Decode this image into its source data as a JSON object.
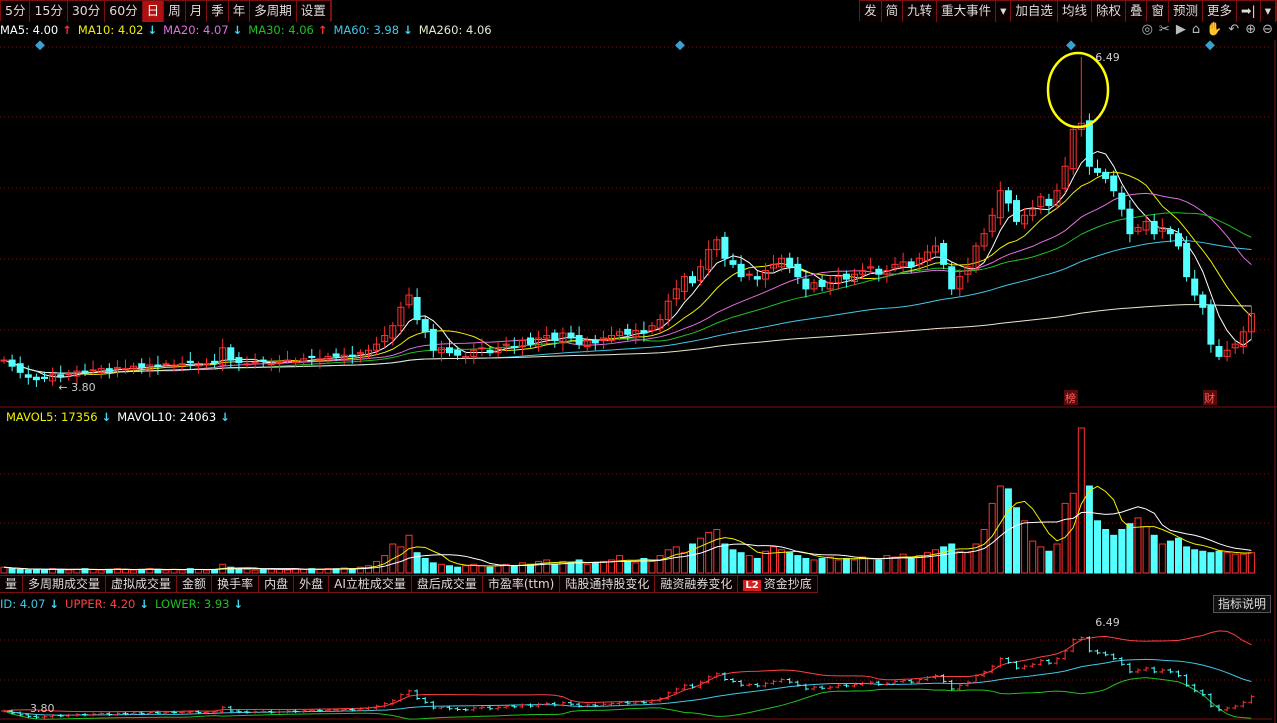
{
  "toolbar_left": [
    "5分",
    "15分",
    "30分",
    "60分",
    "日",
    "周",
    "月",
    "季",
    "年",
    "多周期",
    "设置"
  ],
  "toolbar_left_active": "日",
  "toolbar_right": [
    "发",
    "简",
    "九转",
    "重大事件",
    "▾",
    "加自选",
    "均线",
    "除权",
    "叠",
    "窗",
    "预测",
    "更多",
    "➡|",
    "▾"
  ],
  "chart_icons": [
    "eye-icon",
    "scissors-icon",
    "play-icon",
    "lock-icon",
    "hand-icon",
    "undo-icon",
    "zoom-in-icon",
    "zoom-out-icon"
  ],
  "chart_icon_glyphs": [
    "◎",
    "✂",
    "▶",
    "⌂",
    "✋",
    "↶",
    "⊕",
    "⊖"
  ],
  "ma_legend": [
    {
      "label": "MA5: 4.00",
      "arrow": "↑",
      "color": "#ffffff",
      "trend": "up"
    },
    {
      "label": "MA10: 4.02",
      "arrow": "↓",
      "color": "#f0f000",
      "trend": "down"
    },
    {
      "label": "MA20: 4.07",
      "arrow": "↓",
      "color": "#e070e0",
      "trend": "down"
    },
    {
      "label": "MA30: 4.06",
      "arrow": "↑",
      "color": "#20c020",
      "trend": "up"
    },
    {
      "label": "MA60: 3.98",
      "arrow": "↓",
      "color": "#40c8e8",
      "trend": "down"
    },
    {
      "label": "MA260: 4.06",
      "arrow": "",
      "color": "#e8e8d0",
      "trend": ""
    }
  ],
  "vol_legend": [
    {
      "label": "MAVOL5: 17356",
      "arrow": "↓",
      "color": "#f0f000"
    },
    {
      "label": "MAVOL10: 24063",
      "arrow": "↓",
      "color": "#ffffff"
    }
  ],
  "boll_legend": [
    {
      "label": "ID: 4.07",
      "arrow": "↓",
      "color": "#40c8e8"
    },
    {
      "label": "UPPER: 4.20",
      "arrow": "↓",
      "color": "#ff4040"
    },
    {
      "label": "LOWER: 3.93",
      "arrow": "↓",
      "color": "#20c020"
    }
  ],
  "indicator_tabs": [
    "量",
    "多周期成交量",
    "虚拟成交量",
    "金额",
    "换手率",
    "内盘",
    "外盘",
    "AI立桩成交量",
    "盘后成交量",
    "市盈率(ttm)",
    "陆股通持股变化",
    "融资融券变化",
    "资金抄底"
  ],
  "indicator_tab_badge": "L2",
  "explain_button": "指标说明",
  "markers": {
    "high_label": "6.49",
    "low_label": "3.80",
    "event_labels": [
      "榜",
      "财"
    ]
  },
  "colors": {
    "up": "#ff3030",
    "down": "#54ffff",
    "grid": "#7a1010",
    "highlight_circle": "#ffff00",
    "diamond": "#3aa0d0"
  },
  "chart_data": {
    "type": "candlestick",
    "price_high": 6.49,
    "price_low": 3.8,
    "close": [
      4.02,
      3.97,
      3.92,
      3.88,
      3.86,
      3.87,
      3.9,
      3.89,
      3.91,
      3.93,
      3.92,
      3.94,
      3.95,
      3.93,
      3.96,
      3.95,
      3.97,
      3.96,
      3.98,
      3.97,
      3.99,
      3.98,
      3.99,
      4.0,
      3.98,
      3.99,
      4.0,
      4.12,
      4.02,
      4.0,
      3.99,
      4.0,
      4.01,
      3.99,
      4.0,
      4.02,
      4.01,
      4.03,
      4.04,
      4.03,
      4.05,
      4.05,
      4.06,
      4.05,
      4.08,
      4.1,
      4.15,
      4.22,
      4.3,
      4.45,
      4.55,
      4.35,
      4.25,
      4.1,
      4.12,
      4.08,
      4.06,
      4.05,
      4.1,
      4.12,
      4.08,
      4.12,
      4.15,
      4.13,
      4.18,
      4.15,
      4.2,
      4.22,
      4.18,
      4.24,
      4.2,
      4.15,
      4.18,
      4.16,
      4.2,
      4.22,
      4.25,
      4.23,
      4.26,
      4.24,
      4.3,
      4.35,
      4.5,
      4.6,
      4.7,
      4.65,
      4.78,
      4.92,
      5.0,
      4.85,
      4.8,
      4.7,
      4.72,
      4.68,
      4.75,
      4.8,
      4.85,
      4.78,
      4.7,
      4.6,
      4.65,
      4.62,
      4.65,
      4.7,
      4.68,
      4.72,
      4.75,
      4.78,
      4.72,
      4.75,
      4.8,
      4.82,
      4.78,
      4.85,
      4.9,
      4.95,
      4.8,
      4.6,
      4.7,
      4.78,
      4.95,
      5.05,
      5.2,
      5.4,
      5.3,
      5.15,
      5.2,
      5.25,
      5.35,
      5.28,
      5.4,
      5.6,
      5.9,
      5.95,
      5.6,
      5.55,
      5.5,
      5.4,
      5.25,
      5.05,
      5.1,
      5.15,
      5.05,
      5.1,
      5.05,
      4.95,
      4.7,
      4.55,
      4.45,
      4.15,
      4.05,
      4.1,
      4.15,
      4.25,
      4.4
    ],
    "volume": [
      4000,
      3000,
      2500,
      2000,
      2500,
      2000,
      3000,
      2500,
      2000,
      2500,
      3000,
      2500,
      2000,
      2500,
      3000,
      2500,
      2000,
      2500,
      3000,
      2500,
      2000,
      2500,
      2000,
      3000,
      2500,
      2000,
      2500,
      6000,
      4000,
      3000,
      2500,
      2000,
      2500,
      3000,
      2500,
      2000,
      3000,
      2500,
      3000,
      2500,
      3000,
      3000,
      3500,
      3000,
      4000,
      5000,
      8000,
      12000,
      20000,
      18000,
      26000,
      14000,
      10000,
      7000,
      6000,
      5000,
      4000,
      5000,
      6000,
      5000,
      4000,
      5000,
      6000,
      5000,
      7000,
      6000,
      8000,
      9000,
      6000,
      8000,
      7000,
      9000,
      6000,
      7000,
      8000,
      9000,
      12000,
      8000,
      7000,
      10000,
      8000,
      12000,
      16000,
      18000,
      14000,
      20000,
      24000,
      28000,
      30000,
      20000,
      16000,
      14000,
      12000,
      10000,
      15000,
      18000,
      16000,
      14000,
      12000,
      10000,
      9000,
      10000,
      11000,
      9000,
      10000,
      9000,
      11000,
      10000,
      9000,
      12000,
      11000,
      13000,
      10000,
      12000,
      14000,
      16000,
      18000,
      20000,
      15000,
      14000,
      20000,
      30000,
      48000,
      60000,
      58000,
      45000,
      36000,
      22000,
      18000,
      15000,
      20000,
      48000,
      55000,
      100000,
      60000,
      36000,
      30000,
      26000,
      30000,
      34000,
      38000,
      32000,
      26000,
      20000,
      22000,
      24000,
      18000,
      16000,
      15000,
      14000,
      15000,
      14000,
      13000,
      13000,
      14000
    ]
  }
}
